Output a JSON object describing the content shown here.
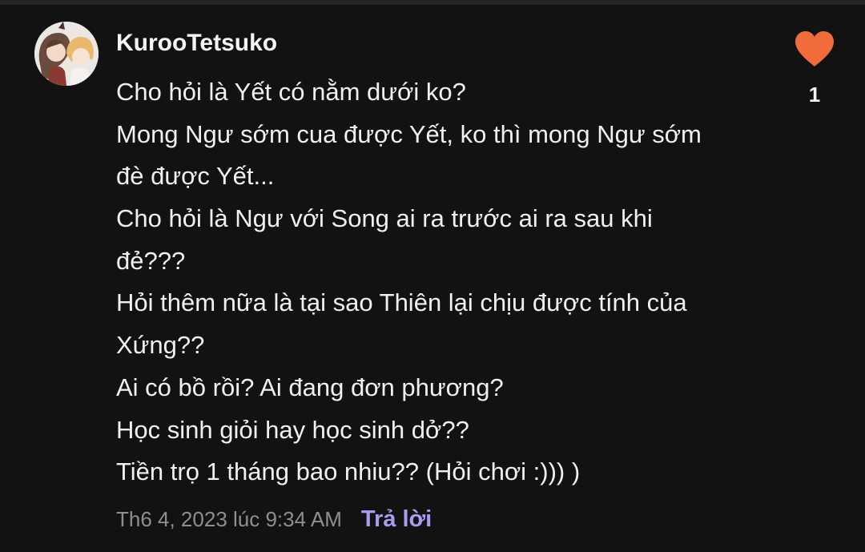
{
  "comment": {
    "username": "KurooTetsuko",
    "avatar_icon": "user-avatar",
    "lines": [
      "Cho hỏi là Yết có nằm dưới ko?",
      "Mong Ngư sớm cua được Yết, ko thì mong Ngư sớm",
      "đè được Yết...",
      "Cho hỏi là Ngư với Song ai ra trước ai ra sau khi",
      "đẻ???",
      "Hỏi thêm nữa là tại sao Thiên lại chịu được tính của",
      "Xứng??",
      "Ai có bồ rồi? Ai đang đơn phương?",
      "Học sinh giỏi hay học sinh dở??",
      "Tiền trọ 1 tháng bao nhiu?? (Hỏi chơi :))) )"
    ],
    "timestamp": "Th6 4, 2023 lúc 9:34 AM",
    "reply_label": "Trả lời",
    "like_icon": "heart-icon",
    "like_count": "1"
  },
  "colors": {
    "background": "#121212",
    "accent_reply": "#a99cf3",
    "heart": "#f26b3a",
    "muted_text": "#8f8f8f"
  }
}
